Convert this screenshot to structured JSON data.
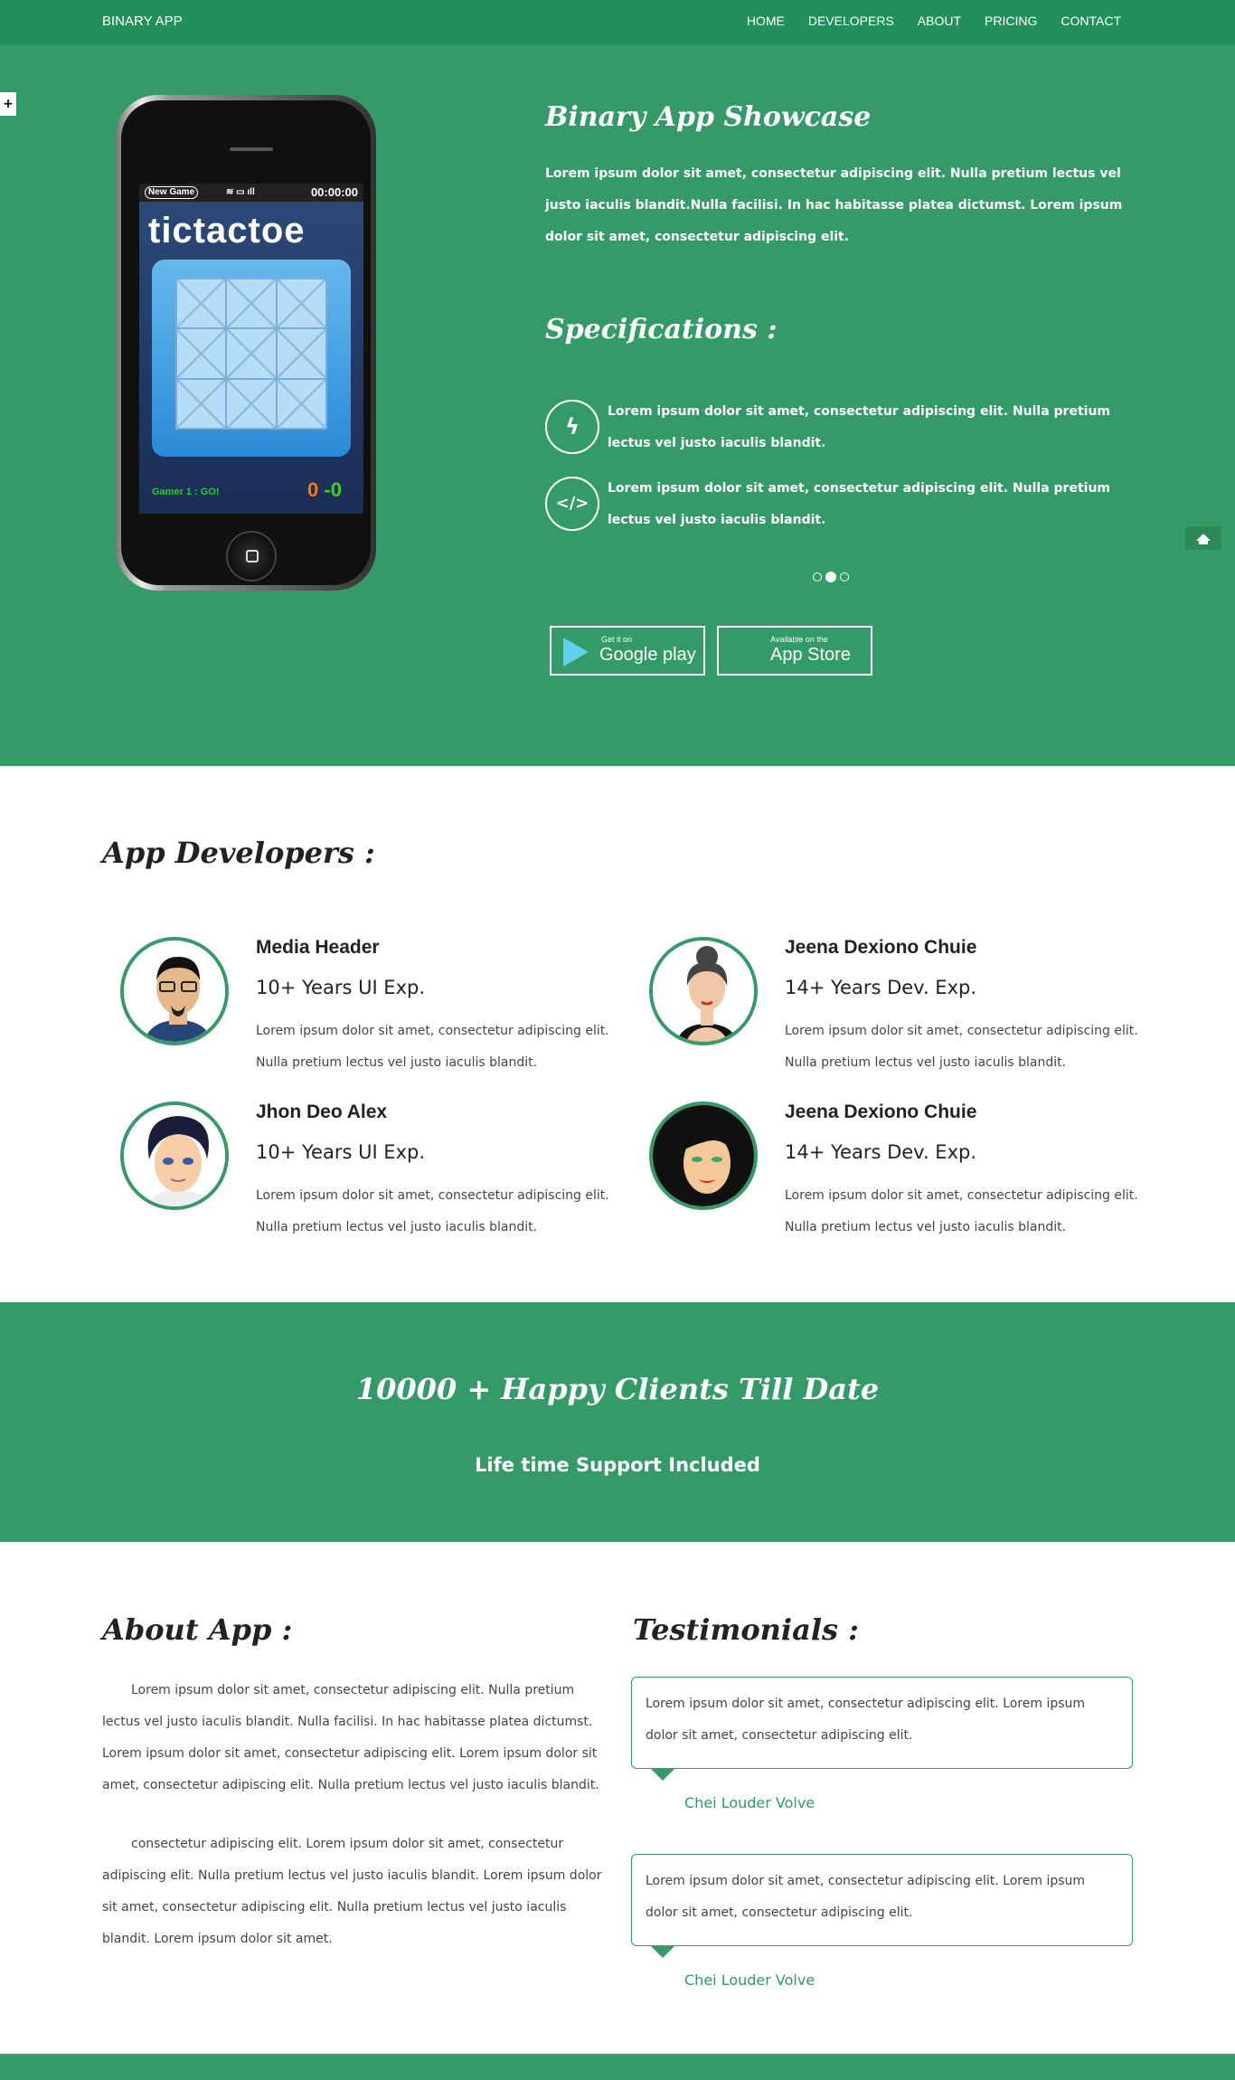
{
  "nav": {
    "brand": "BINARY APP",
    "links": [
      "HOME",
      "DEVELOPERS",
      "ABOUT",
      "PRICING",
      "CONTACT"
    ]
  },
  "hero": {
    "title": "Binary App Showcase",
    "text": "Lorem ipsum dolor sit amet, consectetur adipiscing elit. Nulla pretium lectus vel justo iaculis blandit.Nulla facilisi. In hac habitasse platea dictumst. Lorem ipsum dolor sit amet, consectetur adipiscing elit.",
    "spec_title": "Specifications :",
    "specs": [
      {
        "icon": "bolt-icon",
        "glyph": "ϟ",
        "text": "Lorem ipsum dolor sit amet, consectetur adipiscing elit. Nulla pretium lectus vel justo iaculis blandit."
      },
      {
        "icon": "code-icon",
        "glyph": "</>",
        "text": "Lorem ipsum dolor sit amet, consectetur adipiscing elit. Nulla pretium lectus vel justo iaculis blandit."
      }
    ],
    "google": {
      "small": "Get it on",
      "big": "Google play"
    },
    "apple": {
      "small": "Available on the",
      "big": "App Store"
    },
    "side_plus": "+"
  },
  "phone": {
    "new_game": "New Game",
    "timer": "00:00:00",
    "game_title": "tictactoe",
    "gamer": "Gamer 1 : GO!",
    "score1": "0",
    "score_sep": " -",
    "score2": "0"
  },
  "developers": {
    "title": "App Developers :",
    "items": [
      {
        "name": "Media Header",
        "exp": "10+ Years UI Exp.",
        "desc": "Lorem ipsum dolor sit amet, consectetur adipiscing elit. Nulla pretium lectus vel justo iaculis blandit."
      },
      {
        "name": "Jeena Dexiono Chuie",
        "exp": "14+ Years Dev. Exp.",
        "desc": "Lorem ipsum dolor sit amet, consectetur adipiscing elit. Nulla pretium lectus vel justo iaculis blandit."
      },
      {
        "name": "Jhon Deo Alex",
        "exp": "10+ Years UI Exp.",
        "desc": "Lorem ipsum dolor sit amet, consectetur adipiscing elit. Nulla pretium lectus vel justo iaculis blandit."
      },
      {
        "name": "Jeena Dexiono Chuie",
        "exp": "14+ Years Dev. Exp.",
        "desc": "Lorem ipsum dolor sit amet, consectetur adipiscing elit. Nulla pretium lectus vel justo iaculis blandit."
      }
    ]
  },
  "banner": {
    "title": "10000 + Happy Clients Till Date",
    "subtitle": "Life time Support Included"
  },
  "about": {
    "title": "About App :",
    "p1": "Lorem ipsum dolor sit amet, consectetur adipiscing elit. Nulla pretium lectus vel justo iaculis blandit. Nulla facilisi. In hac habitasse platea dictumst. Lorem ipsum dolor sit amet, consectetur adipiscing elit. Lorem ipsum dolor sit amet, consectetur adipiscing elit. Nulla pretium lectus vel justo iaculis blandit.",
    "p2": "consectetur adipiscing elit. Lorem ipsum dolor sit amet, consectetur adipiscing elit. Nulla pretium lectus vel justo iaculis blandit. Lorem ipsum dolor sit amet, consectetur adipiscing elit. Nulla pretium lectus vel justo iaculis blandit. Lorem ipsum dolor sit amet."
  },
  "testimonials": {
    "title": "Testimonials :",
    "items": [
      {
        "text": "Lorem ipsum dolor sit amet, consectetur adipiscing elit. Lorem ipsum dolor sit amet, consectetur adipiscing elit.",
        "author": "Chei Louder Volve"
      },
      {
        "text": "Lorem ipsum dolor sit amet, consectetur adipiscing elit. Lorem ipsum dolor sit amet, consectetur adipiscing elit.",
        "author": "Chei Louder Volve"
      }
    ]
  },
  "colors": {
    "primary": "#349a67",
    "nav": "#23905c"
  }
}
